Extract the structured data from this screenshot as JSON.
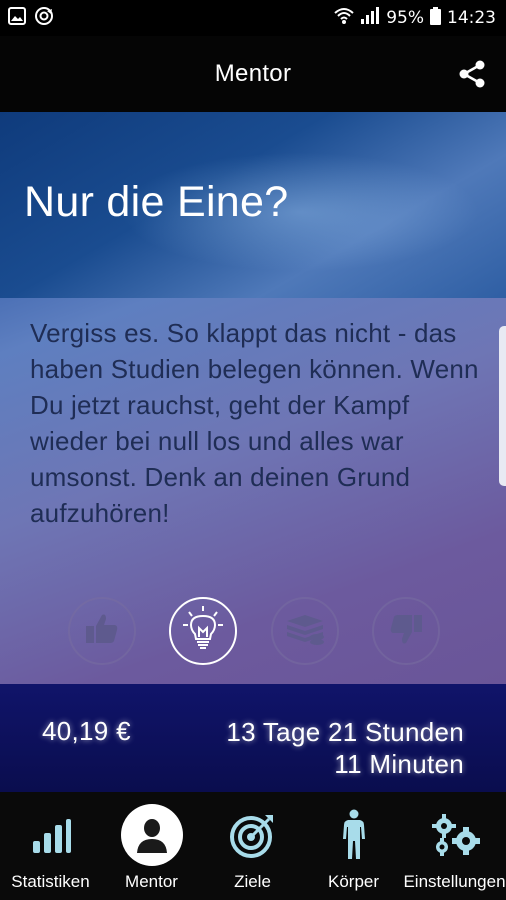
{
  "status_bar": {
    "battery": "95%",
    "time": "14:23",
    "icons": [
      "image-icon",
      "sync-icon",
      "wifi-icon",
      "signal-icon",
      "battery-icon"
    ]
  },
  "app_bar": {
    "title": "Mentor",
    "share_icon": "share-icon"
  },
  "card": {
    "headline": "Nur die Eine?",
    "body": "Vergiss es. So klappt das nicht - das haben Studien belegen können. Wenn Du jetzt rauchst, geht der Kampf wieder bei null los und alles war umsonst. Denk an deinen Grund aufzuhören!",
    "actions": [
      {
        "icon": "thumbs-up-icon",
        "active": false
      },
      {
        "icon": "lightbulb-icon",
        "active": true
      },
      {
        "icon": "money-stack-icon",
        "active": false
      },
      {
        "icon": "thumbs-down-icon",
        "active": false
      }
    ]
  },
  "stats": {
    "money_saved": "40,19 €",
    "time_line1": "13 Tage 21 Stunden",
    "time_line2": "11 Minuten"
  },
  "bottom_nav": {
    "items": [
      {
        "label": "Statistiken",
        "icon": "bar-chart-icon",
        "active": false
      },
      {
        "label": "Mentor",
        "icon": "person-icon",
        "active": true
      },
      {
        "label": "Ziele",
        "icon": "target-icon",
        "active": false
      },
      {
        "label": "Körper",
        "icon": "body-icon",
        "active": false
      },
      {
        "label": "Einstellungen",
        "icon": "gears-icon",
        "active": false
      }
    ]
  },
  "colors": {
    "accent_nav": "#a8dcea",
    "footer_bg": "#10146a",
    "body_text": "#1f2d55"
  }
}
